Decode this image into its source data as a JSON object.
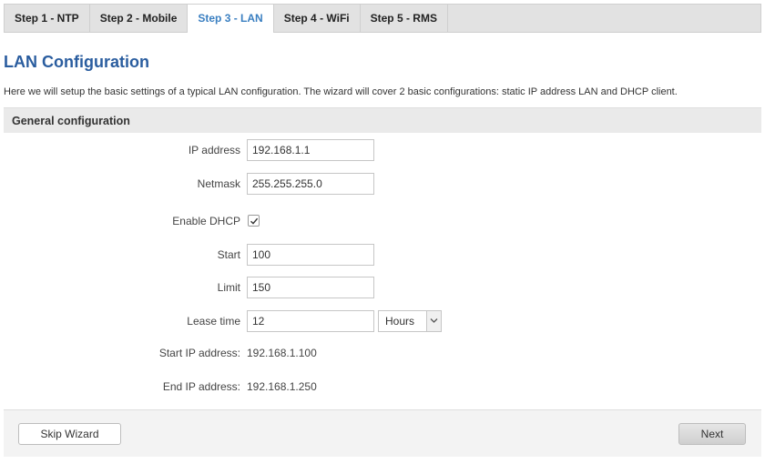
{
  "tabs": [
    {
      "label": "Step 1 - NTP",
      "active": false
    },
    {
      "label": "Step 2 - Mobile",
      "active": false
    },
    {
      "label": "Step 3 - LAN",
      "active": true
    },
    {
      "label": "Step 4 - WiFi",
      "active": false
    },
    {
      "label": "Step 5 - RMS",
      "active": false
    }
  ],
  "page": {
    "title": "LAN Configuration",
    "intro": "Here we will setup the basic settings of a typical LAN configuration. The wizard will cover 2 basic configurations: static IP address LAN and DHCP client."
  },
  "section": {
    "title": "General configuration"
  },
  "form": {
    "ip_address": {
      "label": "IP address",
      "value": "192.168.1.1"
    },
    "netmask": {
      "label": "Netmask",
      "value": "255.255.255.0"
    },
    "enable_dhcp": {
      "label": "Enable DHCP",
      "checked": true
    },
    "start": {
      "label": "Start",
      "value": "100"
    },
    "limit": {
      "label": "Limit",
      "value": "150"
    },
    "lease_time": {
      "label": "Lease time",
      "value": "12",
      "unit": "Hours"
    },
    "start_ip": {
      "label": "Start IP address:",
      "value": "192.168.1.100"
    },
    "end_ip": {
      "label": "End IP address:",
      "value": "192.168.1.250"
    }
  },
  "footer": {
    "skip_label": "Skip Wizard",
    "next_label": "Next"
  },
  "icons": {
    "checkbox_check": "check-icon",
    "select_arrow": "chevron-down-icon"
  },
  "colors": {
    "accent": "#3a7fc1",
    "title": "#2a5d9f"
  }
}
